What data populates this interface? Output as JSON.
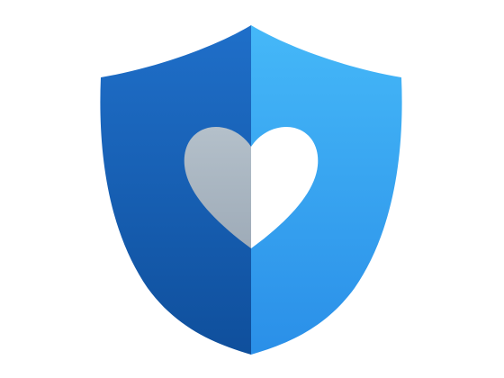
{
  "logo": {
    "icon_name": "shield-heart-icon",
    "colors": {
      "background": "#ffffff",
      "shield_left_top": "#1f6fc9",
      "shield_left_bottom": "#0f4f9c",
      "shield_right_top": "#45b8f8",
      "shield_right_bottom": "#2a8fe8",
      "heart_left": "#b4c0ca",
      "heart_left_bottom": "#9eabb8",
      "heart_right": "#ffffff"
    }
  }
}
